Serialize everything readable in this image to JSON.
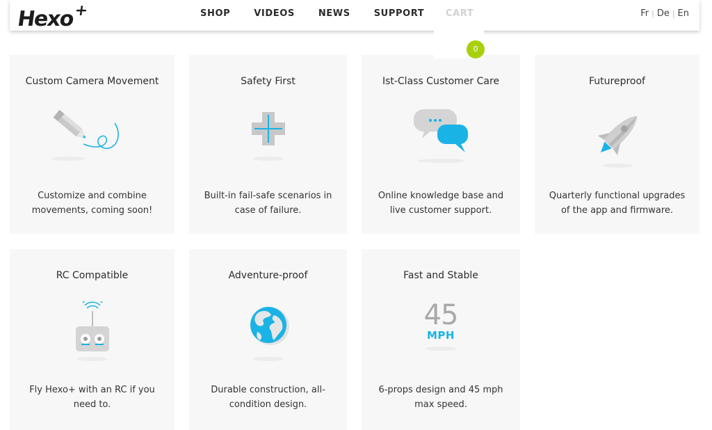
{
  "header": {
    "logo": "Hexo",
    "logo_plus": "+",
    "nav": [
      "SHOP",
      "VIDEOS",
      "NEWS",
      "SUPPORT"
    ],
    "cart_label": "CART",
    "cart_count": "0",
    "languages": [
      "Fr",
      "De",
      "En"
    ]
  },
  "features": [
    {
      "title": "Custom Camera Movement",
      "description": "Customize and combine movements, coming soon!",
      "icon": "pencil-path-icon"
    },
    {
      "title": "Safety First",
      "description": "Built-in fail-safe scenarios in case of failure.",
      "icon": "plus-cross-icon"
    },
    {
      "title": "Ist-Class Customer Care",
      "description": "Online knowledge base and live customer support.",
      "icon": "chat-bubbles-icon"
    },
    {
      "title": "Futureproof",
      "description": "Quarterly functional upgrades of the app and firmware.",
      "icon": "rocket-icon"
    },
    {
      "title": "RC Compatible",
      "description": "Fly Hexo+ with an RC if you need to.",
      "icon": "rc-controller-icon"
    },
    {
      "title": "Adventure-proof",
      "description": "Durable construction, all-condition design.",
      "icon": "globe-icon"
    },
    {
      "title": "Fast and Stable",
      "description": "6-props design and 45 mph max speed.",
      "icon": "speed-icon",
      "icon_number": "45",
      "icon_unit": "MPH"
    }
  ],
  "colors": {
    "accent": "#1ab3e6",
    "badge": "#a8d10b",
    "card_bg": "#f7f7f7"
  }
}
